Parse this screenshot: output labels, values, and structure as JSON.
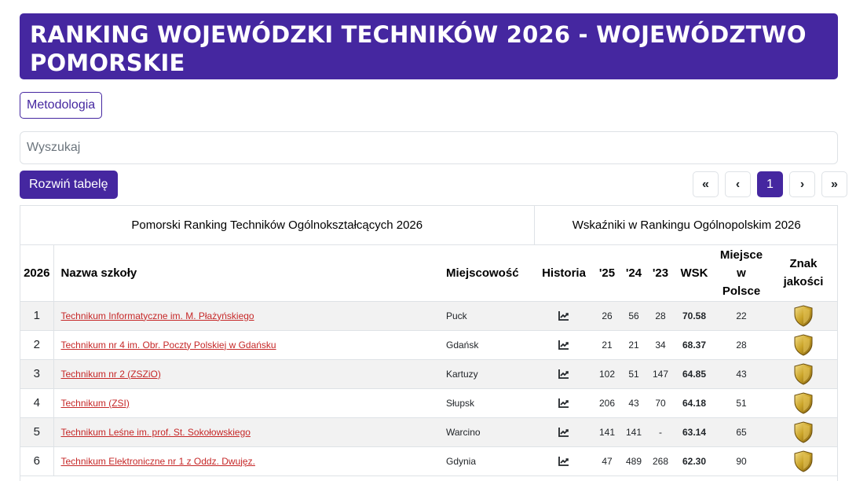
{
  "header": {
    "title": "RANKING WOJEWÓDZKI TECHNIKÓW 2026 - WOJEWÓDZTWO POMORSKIE"
  },
  "methodology_label": "Metodologia",
  "search": {
    "placeholder": "Wyszukaj",
    "value": ""
  },
  "expand_label": "Rozwiń tabelę",
  "pagination": {
    "first": "«",
    "prev": "‹",
    "current": "1",
    "next": "›",
    "last": "»"
  },
  "table": {
    "group_headers": [
      "Pomorski Ranking Techników Ogólnokształcących 2026",
      "Wskaźniki w Rankingu Ogólnopolskim 2026"
    ],
    "columns": {
      "rank": "2026",
      "name": "Nazwa szkoły",
      "city": "Miejscowość",
      "history": "Historia",
      "y25": "'25",
      "y24": "'24",
      "y23": "'23",
      "wsk": "WSK",
      "place_line1": "Miejsce",
      "place_line2": "w",
      "place_line3": "Polsce",
      "quality_line1": "Znak",
      "quality_line2": "jakości"
    },
    "rows": [
      {
        "rank": "1",
        "name": "Technikum Informatyczne im. M. Płażyńskiego",
        "city": "Puck",
        "y25": "26",
        "y24": "56",
        "y23": "28",
        "wsk": "70.58",
        "place": "22",
        "icon": "chart-line-icon",
        "badge": "gold-shield-icon"
      },
      {
        "rank": "2",
        "name": "Technikum nr 4 im. Obr. Poczty Polskiej w Gdańsku",
        "city": "Gdańsk",
        "y25": "21",
        "y24": "21",
        "y23": "34",
        "wsk": "68.37",
        "place": "28",
        "icon": "chart-line-icon",
        "badge": "gold-shield-icon"
      },
      {
        "rank": "3",
        "name": "Technikum nr 2 (ZSZiO)",
        "city": "Kartuzy",
        "y25": "102",
        "y24": "51",
        "y23": "147",
        "wsk": "64.85",
        "place": "43",
        "icon": "chart-line-icon",
        "badge": "gold-shield-icon"
      },
      {
        "rank": "4",
        "name": "Technikum (ZSI)",
        "city": "Słupsk",
        "y25": "206",
        "y24": "43",
        "y23": "70",
        "wsk": "64.18",
        "place": "51",
        "icon": "chart-line-icon",
        "badge": "gold-shield-icon"
      },
      {
        "rank": "5",
        "name": "Technikum Leśne im. prof. St. Sokołowskiego",
        "city": "Warcino",
        "y25": "141",
        "y24": "141",
        "y23": "-",
        "wsk": "63.14",
        "place": "65",
        "icon": "chart-line-icon",
        "badge": "gold-shield-icon"
      },
      {
        "rank": "6",
        "name": "Technikum Elektroniczne nr 1 z Oddz. Dwujęz.",
        "city": "Gdynia",
        "y25": "47",
        "y24": "489",
        "y23": "268",
        "wsk": "62.30",
        "place": "90",
        "icon": "chart-line-icon",
        "badge": "gold-shield-icon"
      }
    ]
  },
  "colors": {
    "primary": "#4527a0",
    "link": "#c62828",
    "gold": "#c9a227"
  }
}
